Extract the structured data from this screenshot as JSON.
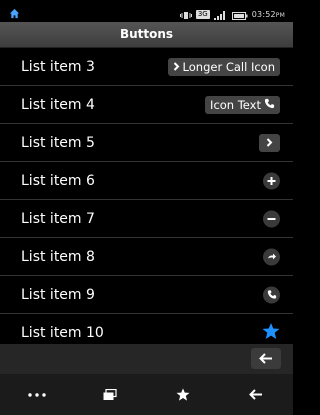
{
  "status": {
    "network_badge": "3G",
    "time": "03:52",
    "time_suffix": "PM",
    "icons": [
      "home-icon",
      "signal-icon",
      "battery-icon"
    ]
  },
  "header": {
    "title": "Buttons"
  },
  "list": {
    "items": [
      {
        "label": "List item 3",
        "button": "Longer Call Icon",
        "icon": "chevron-right-icon"
      },
      {
        "label": "List item 4",
        "button": "Icon Text",
        "icon": "phone-icon"
      },
      {
        "label": "List item 5",
        "icon": "chevron-right-icon"
      },
      {
        "label": "List item 6",
        "icon": "plus-icon"
      },
      {
        "label": "List item 7",
        "icon": "minus-icon"
      },
      {
        "label": "List item 8",
        "icon": "forward-arrow-icon"
      },
      {
        "label": "List item 9",
        "icon": "phone-icon"
      },
      {
        "label": "List item 10",
        "icon": "star-icon"
      }
    ]
  },
  "footer": {
    "back_icon": "back-arrow-icon"
  },
  "navbar": {
    "icons": [
      "more-icon",
      "windows-icon",
      "star-icon",
      "back-icon"
    ]
  },
  "colors": {
    "accent": "#1e90ff",
    "header": "#4a4a4a",
    "button_bg": "#444444"
  }
}
